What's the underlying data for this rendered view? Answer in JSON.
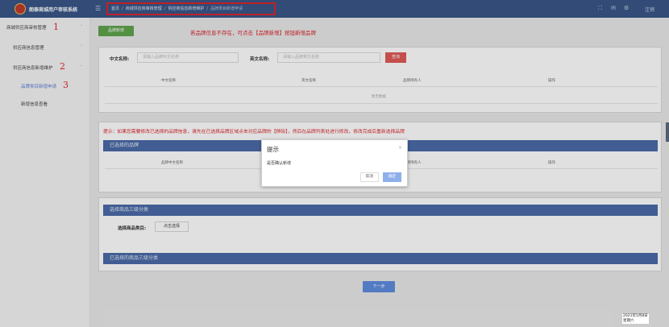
{
  "app": {
    "title": "朗泰商城用户审核系统"
  },
  "breadcrumb": {
    "items": [
      "首页",
      "商城供应商审核管理",
      "供应商信息新增维护"
    ],
    "current": "品牌类目新增申请"
  },
  "header": {
    "logout_label": "注销",
    "icons": [
      "fullscreen-icon",
      "notification-icon",
      "settings-icon"
    ]
  },
  "sidebar": {
    "items": [
      {
        "label": "商城供应商审核管理",
        "active": false
      },
      {
        "label": "供应商信息管理",
        "active": false
      },
      {
        "label": "供应商信息新增维护",
        "active": false
      },
      {
        "label": "品牌类目新增申请",
        "active": true
      },
      {
        "label": "新增信息查看",
        "active": false
      }
    ],
    "annotations": [
      "1",
      "2",
      "3"
    ]
  },
  "brand_search": {
    "add_button": "品牌新增",
    "hint": "若品牌信息不存在，可点击【品牌新增】按钮新增品牌",
    "cn_label": "中文名称:",
    "cn_placeholder": "请输入品牌中文名称",
    "en_label": "英文名称:",
    "en_placeholder": "请输入品牌英文名称",
    "query_button": "查询",
    "columns": [
      "中文名称",
      "英文名称",
      "品牌持有人",
      "操作"
    ],
    "empty_text": "暂无数据"
  },
  "selected_brands": {
    "tip": "提示：如果您需要修改已选择的品牌信息，请先在已选择品牌区域点击对应品牌的【移除】，然后在品牌列表处进行修改，修改完成后重新选择品牌",
    "title": "已选择的品牌",
    "columns": [
      "品牌中文名称",
      "品牌持有人",
      "操作"
    ]
  },
  "category": {
    "title": "选择商品三级分类",
    "select_label": "选择商品类目:",
    "select_button": "点击选择",
    "selected_title": "已选择的商品三级分类"
  },
  "next_button": "下一步",
  "dialog": {
    "title": "提示",
    "close": "×",
    "message": "是否确认新增",
    "cancel": "取消",
    "ok": "确定"
  },
  "taskbar": {
    "date": "2021年5月8日",
    "weekday": "星期六"
  }
}
